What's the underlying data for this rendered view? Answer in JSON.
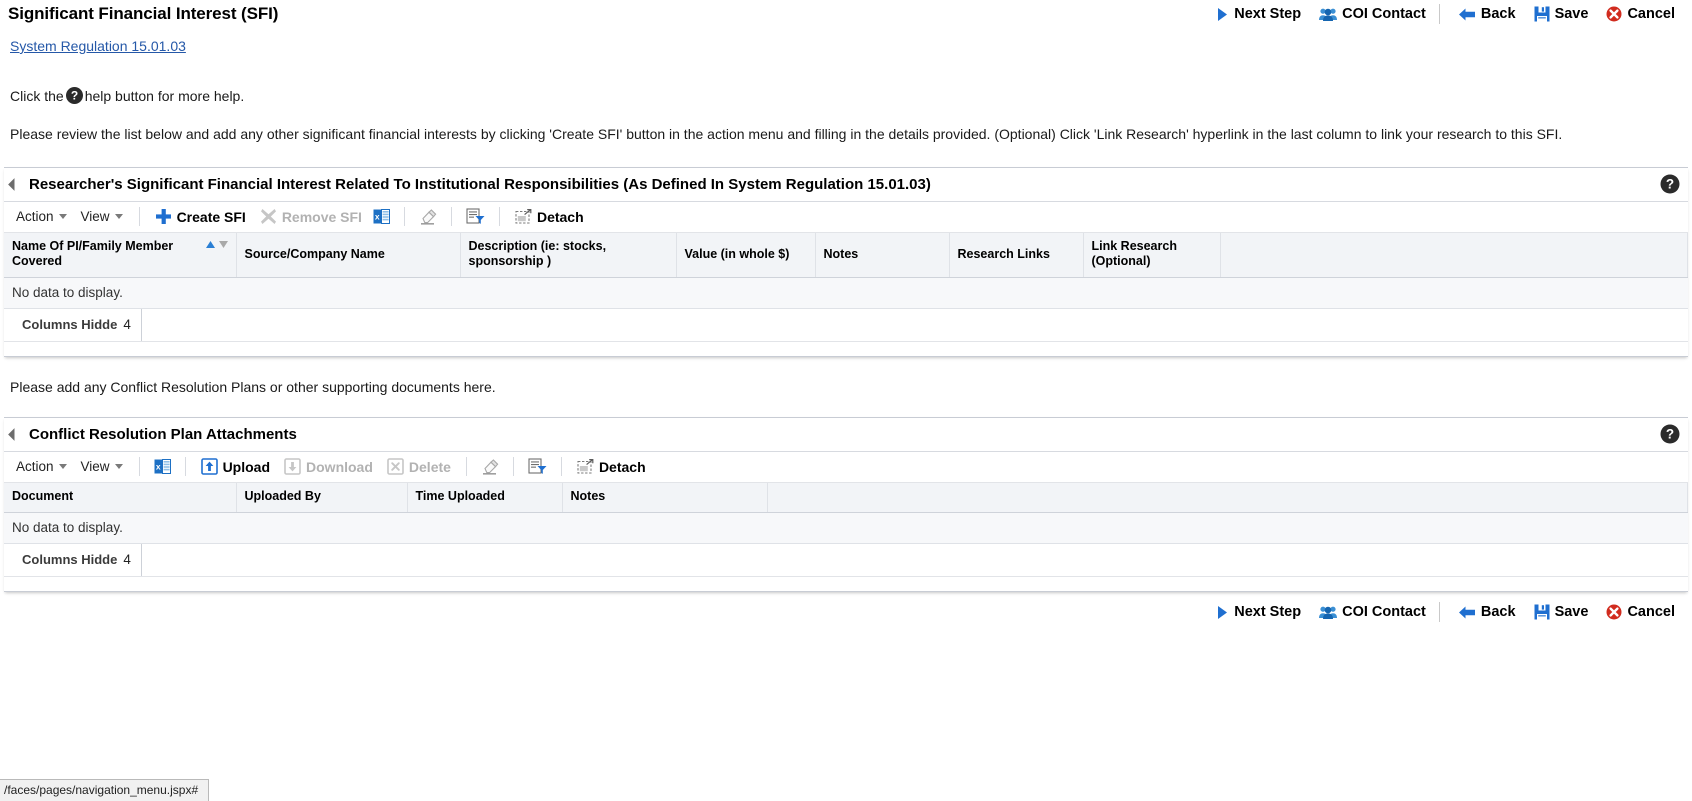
{
  "header": {
    "title": "Significant Financial Interest (SFI)"
  },
  "actions": {
    "next_step": "Next Step",
    "coi_contact": "COI Contact",
    "back": "Back",
    "save": "Save",
    "cancel": "Cancel"
  },
  "body": {
    "regulation_link": "System Regulation 15.01.03",
    "help_prefix": "Click the",
    "help_suffix": "help button for more help.",
    "intro": "Please review the list below and add any other significant financial interests by clicking 'Create SFI' button in the action menu and filling in the details provided. (Optional) Click 'Link Research' hyperlink in the last column to link your research to this SFI.",
    "midtext": "Please add any Conflict Resolution Plans or other supporting documents here."
  },
  "sfi_panel": {
    "title": "Researcher's Significant Financial Interest Related To Institutional Responsibilities (As Defined In System Regulation 15.01.03)",
    "toolbar": {
      "action": "Action",
      "view": "View",
      "create": "Create SFI",
      "remove": "Remove SFI",
      "detach": "Detach"
    },
    "columns": [
      "Name Of PI/Family Member Covered",
      "Source/Company Name",
      "Description (ie: stocks, sponsorship )",
      "Value (in whole $)",
      "Notes",
      "Research Links",
      "Link Research (Optional)"
    ],
    "no_data": "No data to display.",
    "columns_hidden_label": "Columns Hidde",
    "columns_hidden_count": "4"
  },
  "attachments_panel": {
    "title": "Conflict Resolution Plan Attachments",
    "toolbar": {
      "action": "Action",
      "view": "View",
      "upload": "Upload",
      "download": "Download",
      "delete": "Delete",
      "detach": "Detach"
    },
    "columns": [
      "Document",
      "Uploaded By",
      "Time Uploaded",
      "Notes"
    ],
    "no_data": "No data to display.",
    "columns_hidden_label": "Columns Hidde",
    "columns_hidden_count": "4"
  },
  "statusbar": {
    "text": "/faces/pages/navigation_menu.jspx#"
  },
  "colors": {
    "link": "#2558a8",
    "accent_blue": "#1f6fd0",
    "cancel_red": "#d12b1e",
    "excel_green": "#1f6fd0"
  }
}
